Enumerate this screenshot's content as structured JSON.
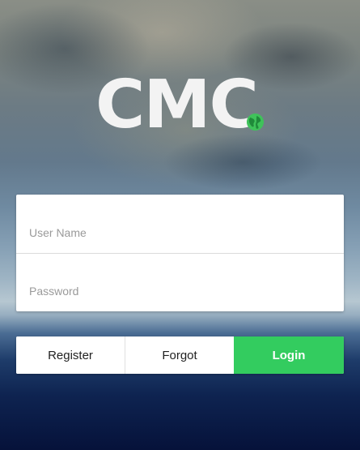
{
  "logo": {
    "text": "CMC",
    "globe_icon": "globe-icon",
    "globe_color": "#3fc25a"
  },
  "login_form": {
    "username": {
      "value": "",
      "placeholder": "User Name"
    },
    "password": {
      "value": "",
      "placeholder": "Password"
    }
  },
  "actions": {
    "register_label": "Register",
    "forgot_label": "Forgot",
    "login_label": "Login",
    "login_color": "#33cc5f"
  }
}
